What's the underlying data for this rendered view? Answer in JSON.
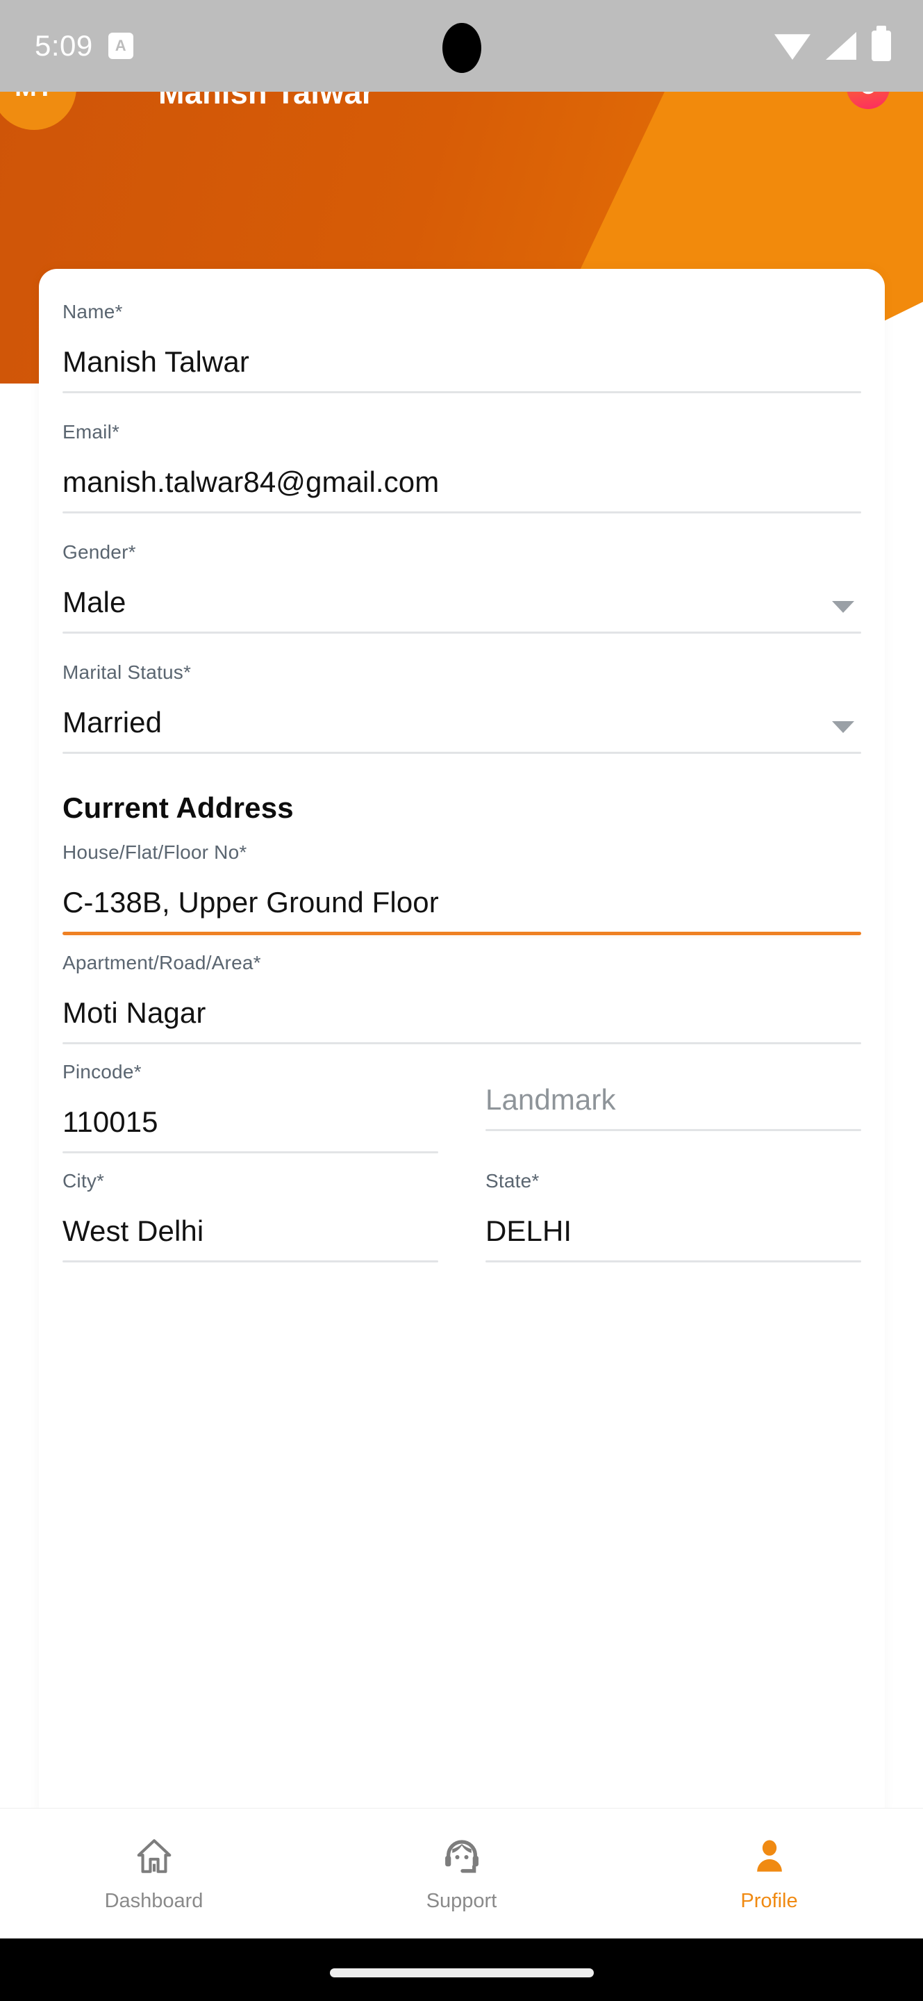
{
  "status_bar": {
    "time": "5:09",
    "badge": "A",
    "icons": [
      "wifi-icon",
      "signal-icon",
      "battery-icon"
    ]
  },
  "header": {
    "avatar_initials": "MT",
    "user_name": "Manish Talwar",
    "logout_icon": "power-icon",
    "colors": {
      "dark": "#CF5508",
      "bright": "#F28A0C",
      "avatar": "#F08C10"
    }
  },
  "form": {
    "personal": [
      {
        "label": "Name*",
        "value": "Manish Talwar",
        "type": "text",
        "focused": false
      },
      {
        "label": "Email*",
        "value": "manish.talwar84@gmail.com",
        "type": "text",
        "focused": false
      },
      {
        "label": "Gender*",
        "value": "Male",
        "type": "dropdown",
        "focused": false
      },
      {
        "label": "Marital Status*",
        "value": "Married",
        "type": "dropdown",
        "focused": false
      }
    ],
    "address_section_title": "Current Address",
    "address": [
      {
        "label": "House/Flat/Floor No*",
        "value": "C-138B, Upper Ground Floor",
        "type": "text",
        "focused": true
      },
      {
        "label": "Apartment/Road/Area*",
        "value": "Moti Nagar",
        "type": "text",
        "focused": false
      }
    ],
    "address_row_1": [
      {
        "label": "Pincode*",
        "value": "110015",
        "type": "text",
        "focused": false
      },
      {
        "label": "",
        "value": "",
        "placeholder": "Landmark",
        "type": "text",
        "focused": false
      }
    ],
    "address_row_2": [
      {
        "label": "City*",
        "value": "West Delhi",
        "type": "text",
        "focused": false
      },
      {
        "label": "State*",
        "value": "DELHI",
        "type": "text",
        "focused": false
      }
    ],
    "focus_color": "#EF8022"
  },
  "bottom_nav": {
    "active": "Profile",
    "active_color": "#F08A12",
    "inactive_color": "#8A8A8A",
    "tabs": [
      {
        "label": "Dashboard",
        "icon": "home-icon",
        "active": false
      },
      {
        "label": "Support",
        "icon": "headset-icon",
        "active": false
      },
      {
        "label": "Profile",
        "icon": "person-icon",
        "active": true
      }
    ]
  }
}
